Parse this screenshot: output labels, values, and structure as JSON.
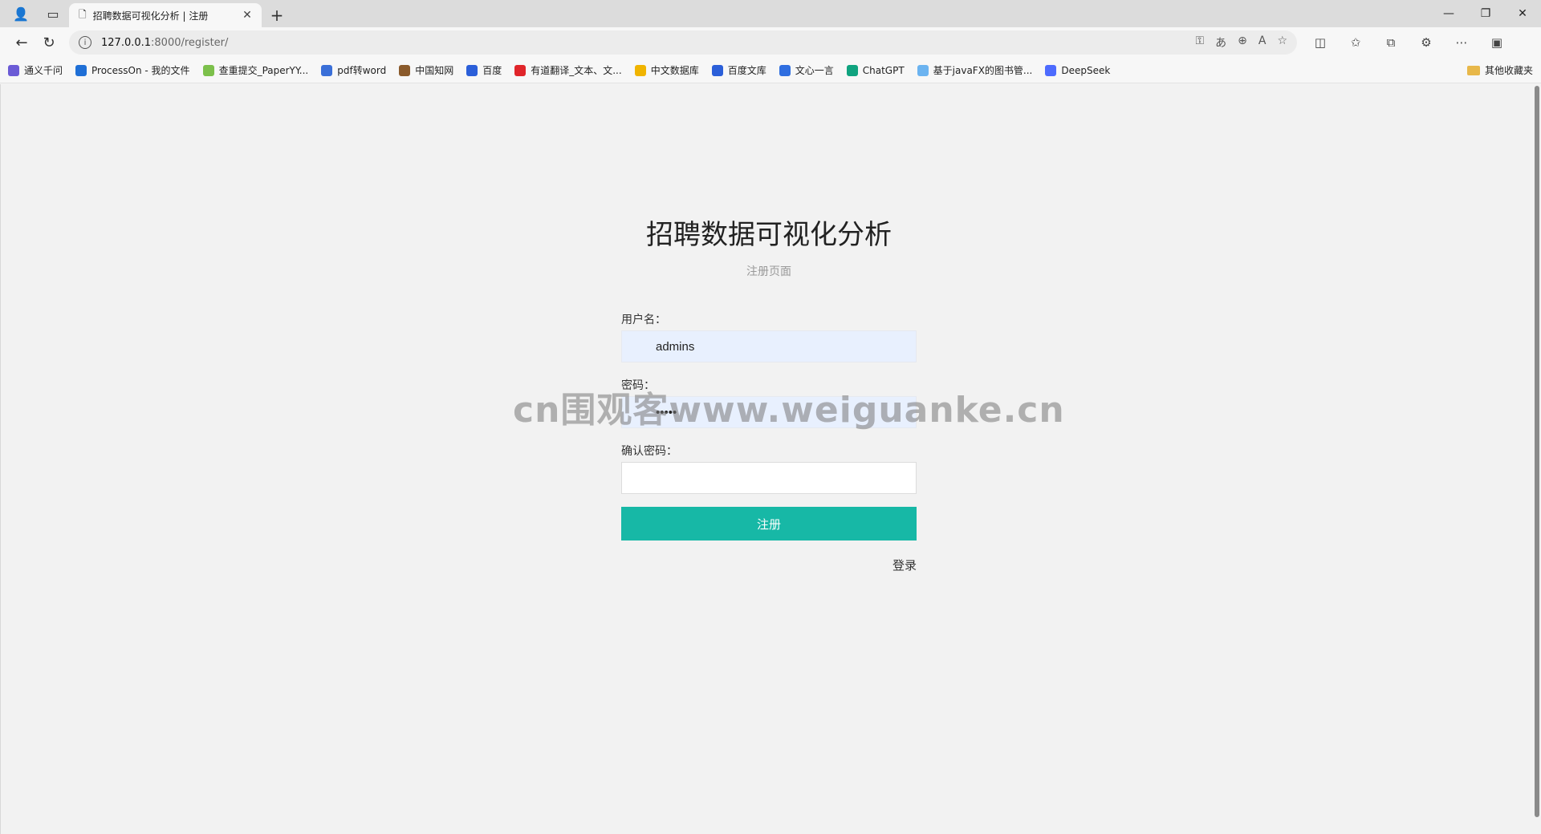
{
  "browser": {
    "tab_title": "招聘数据可视化分析 | 注册",
    "url_host": "127.0.0.1",
    "url_path": ":8000/register/"
  },
  "bookmarks": [
    {
      "label": "通义千问",
      "color": "#6b5bd6"
    },
    {
      "label": "ProcessOn - 我的文件",
      "color": "#1f6fd6"
    },
    {
      "label": "查重提交_PaperYY...",
      "color": "#7cc04b"
    },
    {
      "label": "pdf转word",
      "color": "#3a6fd8"
    },
    {
      "label": "中国知网",
      "color": "#8a5a2b"
    },
    {
      "label": "百度",
      "color": "#2b5fd9"
    },
    {
      "label": "有道翻译_文本、文...",
      "color": "#e0252a"
    },
    {
      "label": "中文数据库",
      "color": "#f0b400"
    },
    {
      "label": "百度文库",
      "color": "#2b5fd9"
    },
    {
      "label": "文心一言",
      "color": "#2f6ee0"
    },
    {
      "label": "ChatGPT",
      "color": "#10a37f"
    },
    {
      "label": "基于javaFX的图书管...",
      "color": "#6bb3f0"
    },
    {
      "label": "DeepSeek",
      "color": "#4d6bfe"
    }
  ],
  "bookmarks_folder": "其他收藏夹",
  "page": {
    "title": "招聘数据可视化分析",
    "subtitle": "注册页面",
    "username_label": "用户名：",
    "username_value": "admins",
    "password_label": "密码：",
    "password_value": "•••••",
    "confirm_label": "确认密码：",
    "confirm_value": "",
    "submit_label": "注册",
    "login_link": "登录"
  },
  "watermark": "cn围观客www.weiguanke.cn"
}
